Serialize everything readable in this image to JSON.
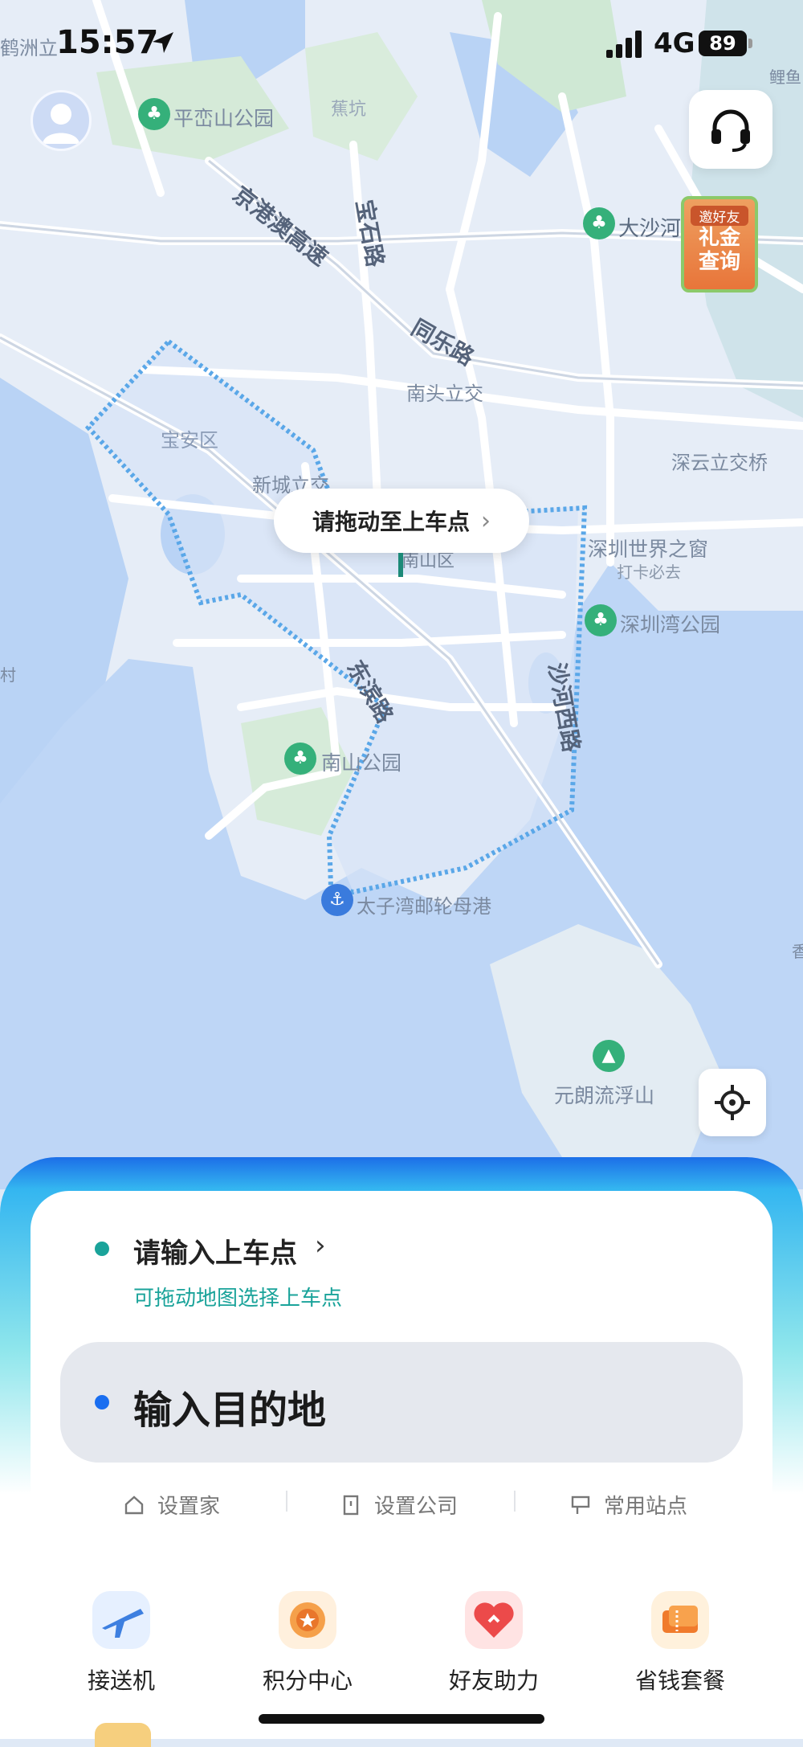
{
  "status_bar": {
    "time": "15:57",
    "network": "4G",
    "battery": "89"
  },
  "map": {
    "labels": {
      "hezhouli": "鹤洲立",
      "pingluanshan": "平峦山公园",
      "jiaokeng": "蕉坑",
      "jinggangao": "京港澳高速",
      "baoshi": "宝石路",
      "tongle": "同乐路",
      "dashahe": "大沙河",
      "nantou": "南头立交",
      "baoan": "宝安区",
      "xincheng": "新城立交",
      "shenyun": "深云立交桥",
      "nanshanqu": "南山区",
      "window_world": "深圳世界之窗",
      "checkin": "打卡必去",
      "bay_park": "深圳湾公园",
      "dongbin": "东滨路",
      "shahexi": "沙河西路",
      "nanshan_park": "南山公园",
      "cruise": "太子湾邮轮母港",
      "yuanlang": "元朗流浮山",
      "edge_left": "村",
      "edge_right": "香",
      "edge_top_right": "鲤鱼"
    },
    "pickup_bubble": "请拖动至上车点",
    "promo": {
      "line1": "邀好友",
      "line2": "礼金",
      "line3": "查询"
    }
  },
  "panel": {
    "pickup_label": "请输入上车点",
    "pickup_hint": "可拖动地图选择上车点",
    "destination": "输入目的地",
    "quick_links": [
      "设置家",
      "设置公司",
      "常用站点"
    ],
    "services": [
      "接送机",
      "积分中心",
      "好友助力",
      "省钱套餐"
    ]
  },
  "colors": {
    "accent": "#1aa39a",
    "dest_dot": "#1a6ef0",
    "route": "#5aa7e8"
  }
}
